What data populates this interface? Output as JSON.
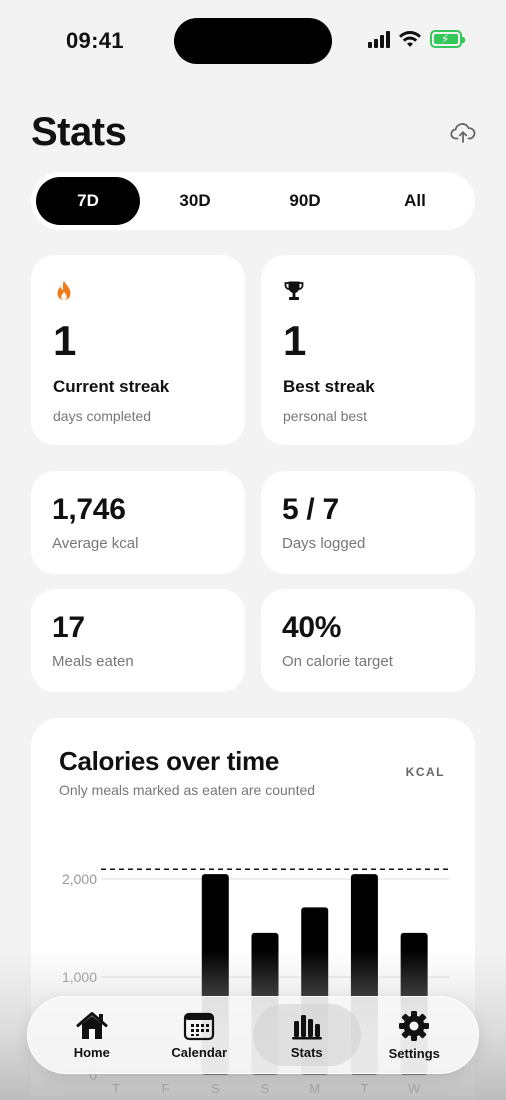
{
  "status_bar": {
    "time": "09:41"
  },
  "header": {
    "title": "Stats",
    "upload_icon": "cloud-upload-icon"
  },
  "range_tabs": [
    {
      "label": "7D",
      "active": true
    },
    {
      "label": "30D",
      "active": false
    },
    {
      "label": "90D",
      "active": false
    },
    {
      "label": "All",
      "active": false
    }
  ],
  "streaks": {
    "current": {
      "value": "1",
      "title": "Current streak",
      "subtitle": "days completed",
      "icon": "flame-icon",
      "icon_color": "#f07a1a"
    },
    "best": {
      "value": "1",
      "title": "Best streak",
      "subtitle": "personal best",
      "icon": "trophy-icon"
    }
  },
  "metrics": [
    {
      "value": "1,746",
      "label": "Average kcal"
    },
    {
      "value": "5 / 7",
      "label": "Days logged"
    },
    {
      "value": "17",
      "label": "Meals eaten"
    },
    {
      "value": "40%",
      "label": "On calorie target"
    }
  ],
  "chart": {
    "title": "Calories over time",
    "subtitle": "Only meals marked as eaten are counted",
    "unit": "KCAL"
  },
  "chart_data": {
    "type": "bar",
    "categories": [
      "T",
      "F",
      "S",
      "S",
      "M",
      "T",
      "W"
    ],
    "values": [
      0,
      0,
      2050,
      1450,
      1710,
      2050,
      1450
    ],
    "target": 2100,
    "ylim": [
      0,
      2100
    ],
    "yticks": [
      0,
      1000,
      2000
    ],
    "ytick_labels": [
      "0",
      "1,000",
      "2,000"
    ],
    "grid": true,
    "bar_color": "#000000"
  },
  "nav": [
    {
      "label": "Home",
      "icon": "home-icon",
      "active": false
    },
    {
      "label": "Calendar",
      "icon": "calendar-icon",
      "active": false
    },
    {
      "label": "Stats",
      "icon": "bar-chart-icon",
      "active": true
    },
    {
      "label": "Settings",
      "icon": "gear-icon",
      "active": false
    }
  ]
}
